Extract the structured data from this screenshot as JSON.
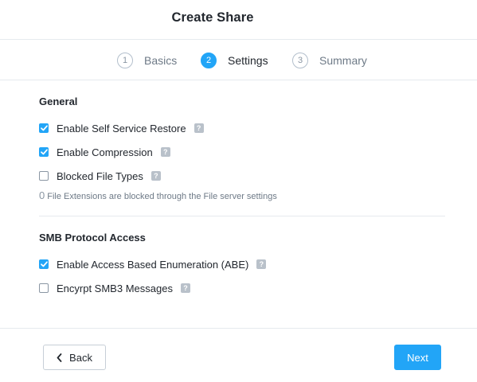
{
  "header": {
    "title": "Create Share"
  },
  "steps": [
    {
      "number": "1",
      "label": "Basics",
      "active": false
    },
    {
      "number": "2",
      "label": "Settings",
      "active": true
    },
    {
      "number": "3",
      "label": "Summary",
      "active": false
    }
  ],
  "general": {
    "title": "General",
    "options": [
      {
        "label": "Enable Self Service Restore",
        "checked": true
      },
      {
        "label": "Enable Compression",
        "checked": true
      },
      {
        "label": "Blocked File Types",
        "checked": false
      }
    ],
    "hint_count": "0",
    "hint_text": "File Extensions are blocked through the File server settings"
  },
  "smb": {
    "title": "SMB Protocol Access",
    "options": [
      {
        "label": "Enable Access Based Enumeration (ABE)",
        "checked": true
      },
      {
        "label": "Encyrpt SMB3 Messages",
        "checked": false
      }
    ]
  },
  "help_glyph": "?",
  "footer": {
    "back_label": "Back",
    "next_label": "Next"
  },
  "colors": {
    "accent": "#22a5f7",
    "help_bg": "#b9c1ca",
    "divider": "#e6eaee"
  },
  "icons": {
    "check": "check-icon",
    "help": "help-icon",
    "back": "chevron-left-icon"
  }
}
